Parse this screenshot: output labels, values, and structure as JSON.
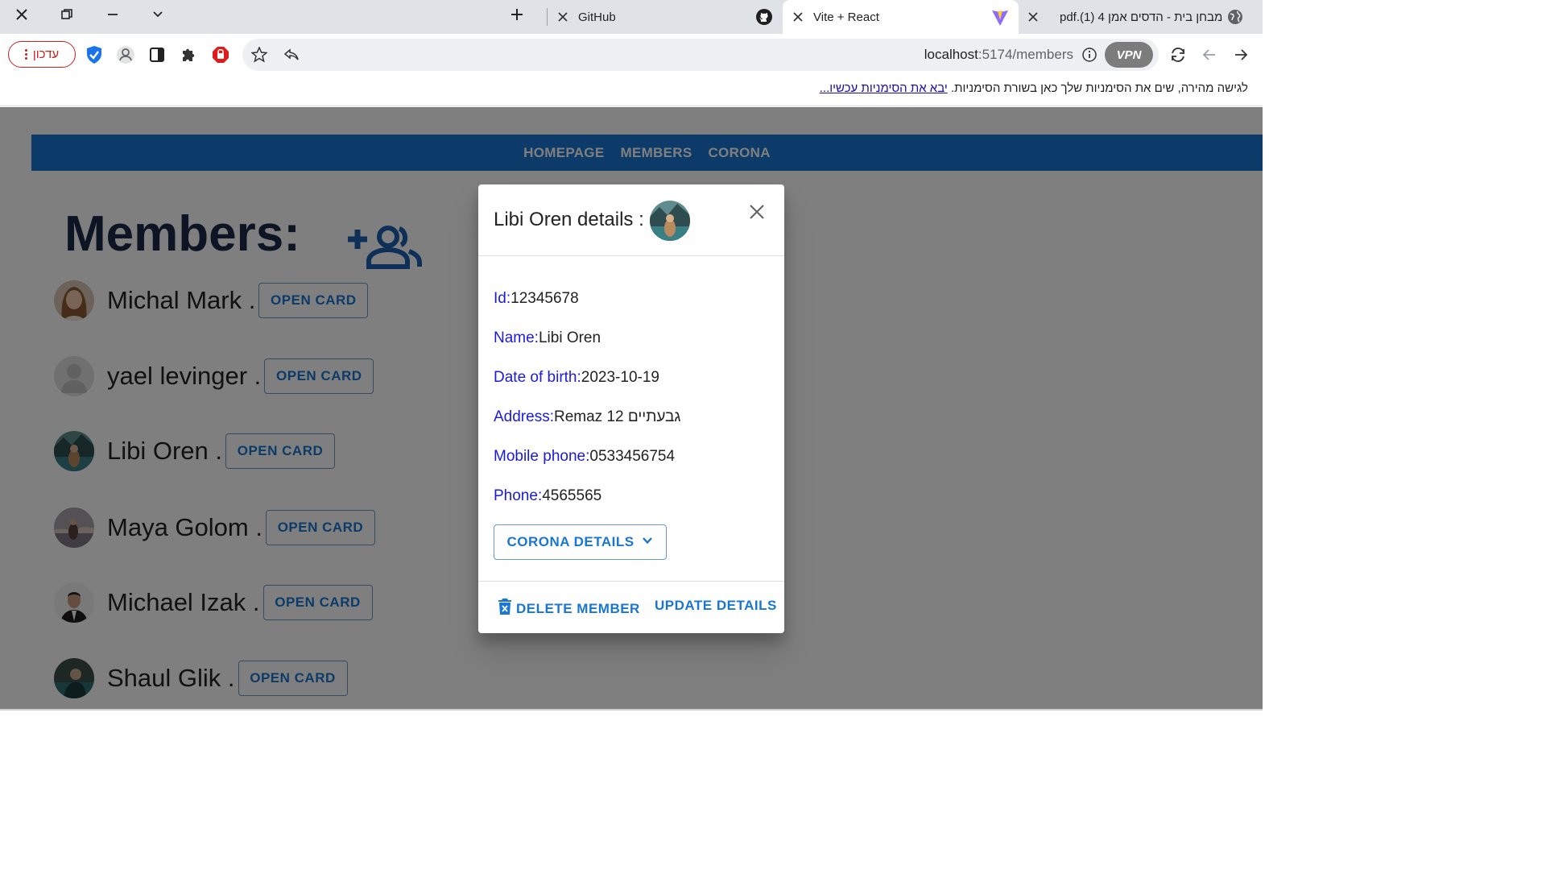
{
  "browser": {
    "tabs": [
      {
        "title": "מבחן בית - הדסים אמן 4 pdf.(1)",
        "icon": "globe-icon"
      },
      {
        "title": "Vite + React",
        "icon": "vite-icon",
        "active": true
      },
      {
        "title": "GitHub",
        "icon": "github-icon"
      }
    ],
    "update_label": "עדכון",
    "url_host": "localhost",
    "url_path": ":5174/members",
    "vpn_label": "VPN",
    "bookmark_text": "לגישה מהירה, שים את הסימניות שלך כאן בשורת הסימניות.",
    "bookmark_link": "יבא את הסימניות עכשיו..."
  },
  "nav": [
    "HOMEPAGE",
    "MEMBERS",
    "CORONA"
  ],
  "page_title": "Members:",
  "open_card_label": "OPEN CARD",
  "members": [
    {
      "name": "Michal Mark ."
    },
    {
      "name": "yael levinger ."
    },
    {
      "name": "Libi Oren ."
    },
    {
      "name": "Maya Golom ."
    },
    {
      "name": "Michael Izak ."
    },
    {
      "name": "Shaul Glik ."
    }
  ],
  "dialog": {
    "title": "Libi Oren details :",
    "fields": [
      {
        "label": "Id:",
        "value": "12345678"
      },
      {
        "label": "Name:",
        "value": "Libi Oren"
      },
      {
        "label": "Date of birth:",
        "value": "2023-10-19"
      },
      {
        "label": "Address:",
        "value": "Remaz 12 גבעתיים"
      },
      {
        "label": "Mobile phone:",
        "value": "0533456754"
      },
      {
        "label": "Phone:",
        "value": "4565565"
      }
    ],
    "corona_label": "CORONA DETAILS",
    "delete_label": "DELETE MEMBER",
    "update_label": "UPDATE DETAILS"
  },
  "colors": {
    "accent": "#1976d2",
    "label_blue": "#1a1ae0",
    "title_navy": "#1a2b48"
  }
}
